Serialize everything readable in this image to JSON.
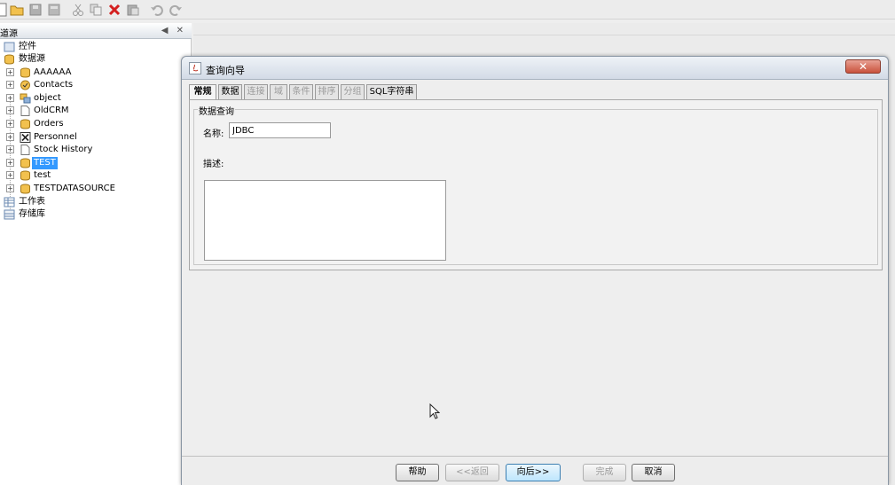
{
  "left_panel": {
    "title": "道源",
    "header_buttons": "◀ ✕",
    "tree": {
      "controls": "控件",
      "datasource": "数据源",
      "items": [
        "AAAAAA",
        "Contacts",
        "object",
        "OldCRM",
        "Orders",
        "Personnel",
        "Stock History",
        "TEST",
        "test",
        "TESTDATASOURCE"
      ],
      "worksheet": "工作表",
      "repository": "存储库"
    }
  },
  "dialog": {
    "title": "查询向导",
    "close": "✕",
    "tabs": [
      {
        "label": "常规",
        "state": "active"
      },
      {
        "label": "数据",
        "state": "normal"
      },
      {
        "label": "连接",
        "state": "disabled"
      },
      {
        "label": "域",
        "state": "disabled"
      },
      {
        "label": "条件",
        "state": "disabled"
      },
      {
        "label": "排序",
        "state": "disabled"
      },
      {
        "label": "分组",
        "state": "disabled"
      },
      {
        "label": "SQL字符串",
        "state": "normal"
      }
    ],
    "group_title": "数据查询",
    "name_label": "名称:",
    "name_value": "JDBC",
    "desc_label": "描述:",
    "buttons": {
      "help": "帮助",
      "back": "<<返回",
      "next": "向后>>",
      "finish": "完成",
      "cancel": "取消"
    }
  },
  "icons": [
    "new-icon",
    "open-folder-icon",
    "save-icon",
    "save-all-icon",
    "cut-icon",
    "copy-icon",
    "delete-icon",
    "paste-icon",
    "undo-icon",
    "redo-icon"
  ]
}
